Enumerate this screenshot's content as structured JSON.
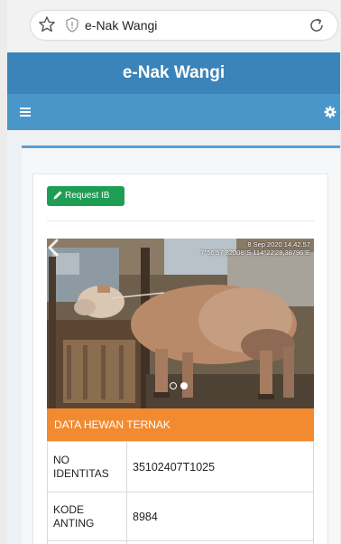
{
  "browser": {
    "url_text": "e-Nak Wangi"
  },
  "header": {
    "title": "e-Nak Wangi"
  },
  "nav": {
    "menu_icon": "hamburger-icon",
    "settings_icon": "gear-icon"
  },
  "card": {
    "request_button_label": "Request IB",
    "photo": {
      "stamp_line1": "8 Sep 2020 14.42.57",
      "stamp_line2": "7°56'57,82008\"S 114°22'28,38796\"E",
      "slide_count": 2,
      "active_slide": 2
    },
    "section_title": "DATA HEWAN TERNAK",
    "rows": [
      {
        "label": "NO IDENTITAS",
        "value": "35102407T1025"
      },
      {
        "label": "KODE ANTING",
        "value": "8984"
      }
    ]
  },
  "colors": {
    "header_bg": "#3a84b9",
    "nav_bg": "#4a96c8",
    "button_green": "#1e9e54",
    "section_orange": "#f28a30"
  }
}
